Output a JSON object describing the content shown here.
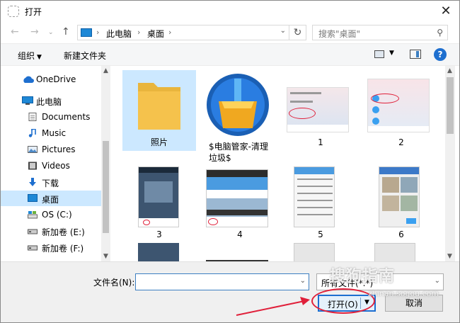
{
  "window": {
    "title": "打开",
    "close_glyph": "✕"
  },
  "address": {
    "back_glyph": "←",
    "forward_glyph": "→",
    "up_glyph": "↑",
    "crumbs": [
      "此电脑",
      "桌面"
    ],
    "sep_glyph": "›",
    "refresh_glyph": "↻",
    "search_placeholder": "搜索\"桌面\""
  },
  "toolbar": {
    "organize": "组织",
    "new_folder": "新建文件夹",
    "help": "?"
  },
  "sidebar": {
    "items": [
      {
        "label": "OneDrive",
        "icon": "cloud-icon"
      },
      {
        "label": "此电脑",
        "icon": "pc-icon"
      },
      {
        "label": "Documents",
        "icon": "document-icon"
      },
      {
        "label": "Music",
        "icon": "music-icon"
      },
      {
        "label": "Pictures",
        "icon": "pictures-icon"
      },
      {
        "label": "Videos",
        "icon": "videos-icon"
      },
      {
        "label": "下载",
        "icon": "download-icon"
      },
      {
        "label": "桌面",
        "icon": "desktop-icon",
        "selected": true
      },
      {
        "label": "OS (C:)",
        "icon": "drive-icon"
      },
      {
        "label": "新加卷 (E:)",
        "icon": "drive-icon"
      },
      {
        "label": "新加卷 (F:)",
        "icon": "drive-icon"
      }
    ]
  },
  "files": [
    {
      "label": "照片",
      "kind": "folder",
      "selected": true
    },
    {
      "label": "$电脑管家-清理垃圾$",
      "kind": "app"
    },
    {
      "label": "1",
      "kind": "screenshot"
    },
    {
      "label": "2",
      "kind": "screenshot"
    },
    {
      "label": "3",
      "kind": "phone"
    },
    {
      "label": "4",
      "kind": "screenshot"
    },
    {
      "label": "5",
      "kind": "phone"
    },
    {
      "label": "6",
      "kind": "phone"
    }
  ],
  "bottom": {
    "filename_label": "文件名(N):",
    "filename_value": "",
    "filetype": "所有文件(*.*)",
    "open_label": "打开(O)",
    "cancel_label": "取消"
  },
  "watermark": {
    "main": "搜狗指南",
    "sub": "zhinan.sogou.com"
  },
  "colors": {
    "accent": "#1d6fd1",
    "selection": "#cce8ff",
    "annotation": "#e0203a",
    "folder": "#f5c24c"
  }
}
